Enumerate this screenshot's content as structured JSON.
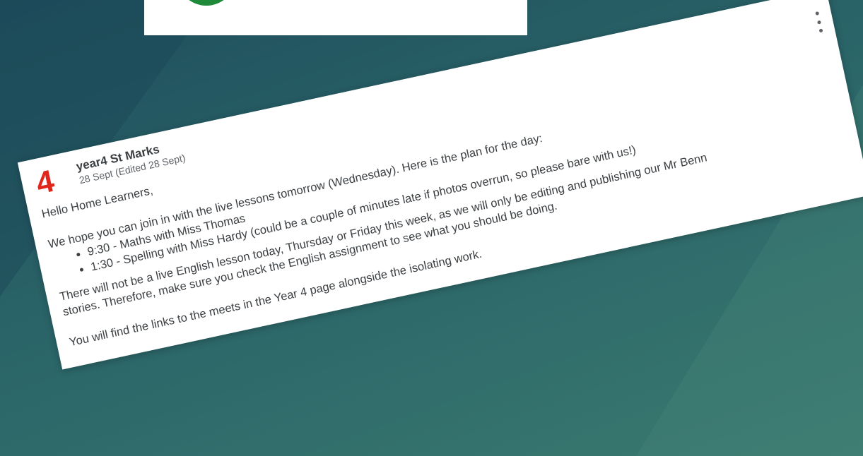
{
  "post": {
    "avatar_text": "4",
    "author": "year4 St Marks",
    "date": "28 Sept (Edited 28 Sept)",
    "greeting": "Hello Home Learners,",
    "intro": "We hope you can join in with the live lessons tomorrow (Wednesday). Here is the plan for the day:",
    "schedule": [
      "9:30 - Maths with Miss Thomas",
      "1:30 - Spelling with Miss Hardy (could be a couple of minutes late if photos overrun, so please bare with us!)"
    ],
    "english_note_line1": "There will not be a live English lesson today, Thursday or Friday this week, as we will only be editing and publishing our Mr Benn",
    "english_note_line2": "stories. Therefore, make sure you check the English assignment to see what you should be doing.",
    "links_note": "You will find the links to the meets in the Year 4 page alongside the isolating work."
  },
  "colors": {
    "avatar": "#e0271c",
    "background_start": "#1e4d5c",
    "background_end": "#3a7a70",
    "accent_green": "#1e8a3a"
  },
  "icons": {
    "menu": "more-vert-icon"
  }
}
